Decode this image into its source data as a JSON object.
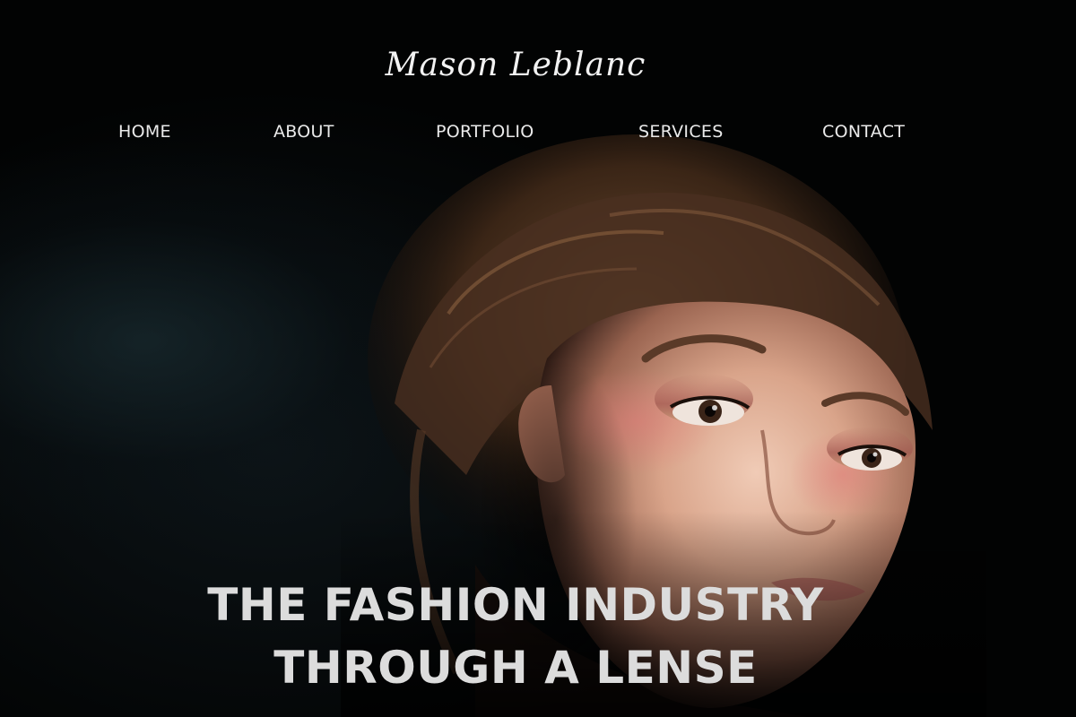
{
  "brand": {
    "logo_text": "Mason Leblanc"
  },
  "nav": {
    "items": [
      {
        "label": "HOME"
      },
      {
        "label": "ABOUT"
      },
      {
        "label": "PORTFOLIO"
      },
      {
        "label": "SERVICES"
      },
      {
        "label": "CONTACT"
      }
    ]
  },
  "hero": {
    "headline_line1": "THE FASHION INDUSTRY",
    "headline_line2": "THROUGH A LENSE",
    "image_subject": "fashion-model-portrait"
  },
  "colors": {
    "background": "#020303",
    "nav_text": "#eaeaea",
    "headline_text": "#dcdcdc"
  }
}
